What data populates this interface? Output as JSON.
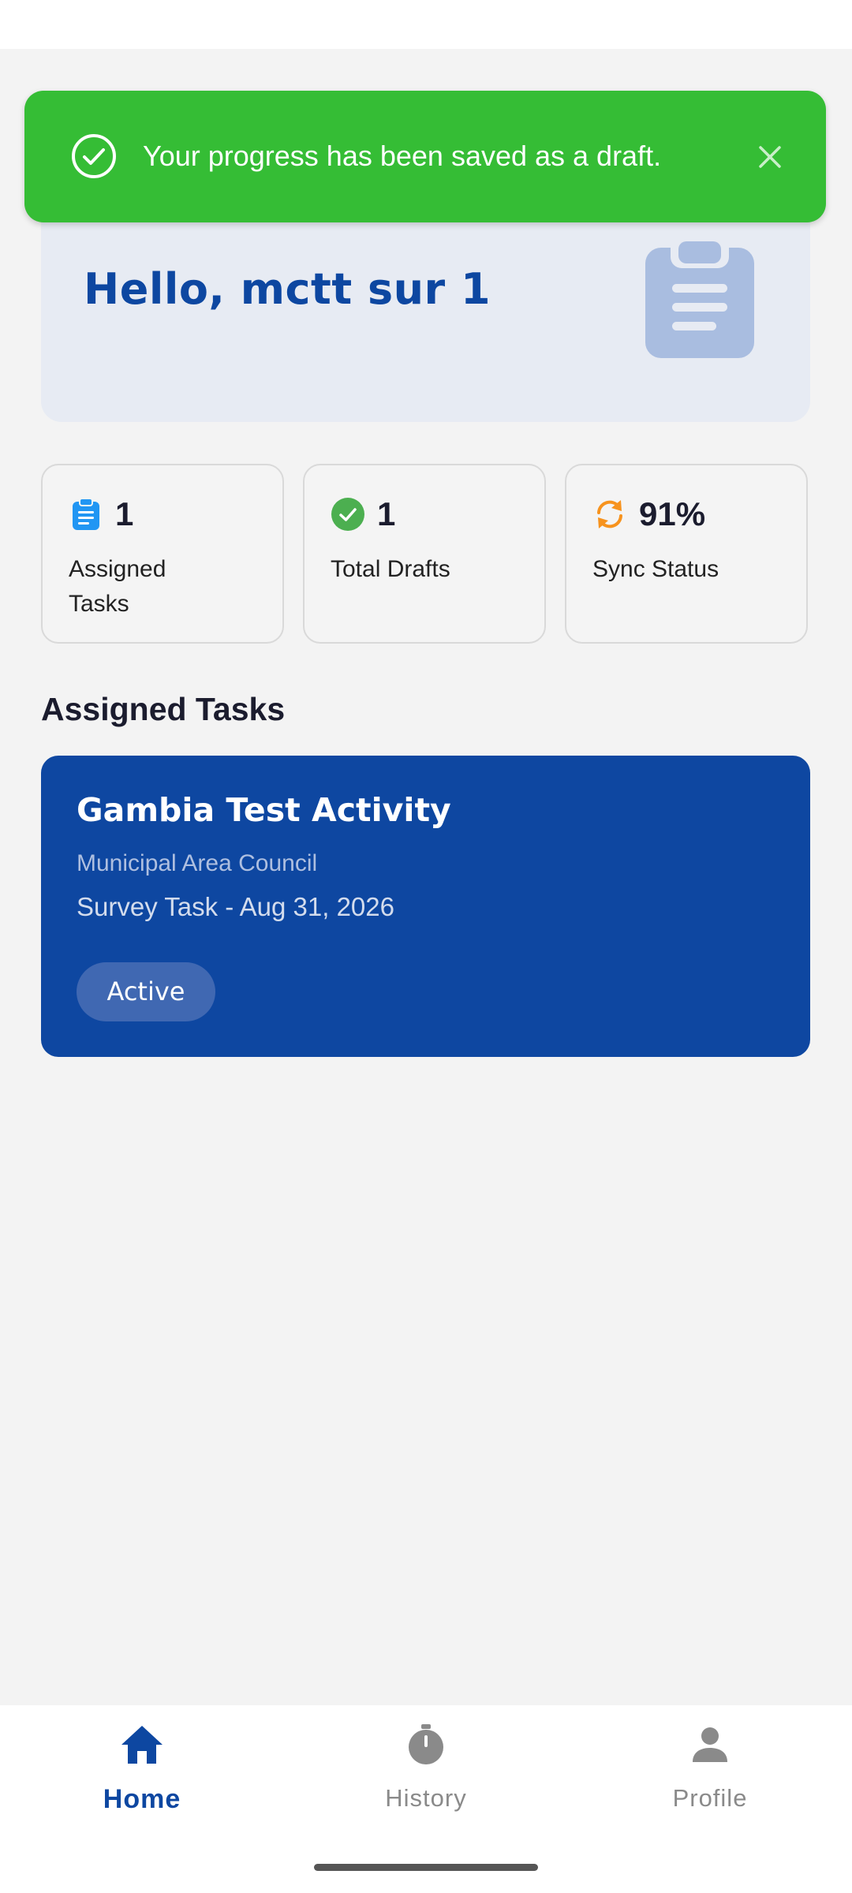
{
  "toast": {
    "message": "Your progress has been saved as a draft.",
    "icon": "check-circle-icon",
    "close_icon": "close-icon",
    "color": "#35bd35"
  },
  "greeting": {
    "text": "Hello, mctt sur 1",
    "illustration": "clipboard-icon"
  },
  "stats": [
    {
      "value": "1",
      "label": "Assigned Tasks",
      "icon": "clipboard-icon",
      "icon_color": "#2196f3"
    },
    {
      "value": "1",
      "label": "Total Drafts",
      "icon": "check-circle-icon",
      "icon_color": "#4caf50"
    },
    {
      "value": "91%",
      "label": "Sync Status",
      "icon": "sync-icon",
      "icon_color": "#f7931e"
    }
  ],
  "section_title": "Assigned Tasks",
  "task": {
    "title": "Gambia Test Activity",
    "subtitle": "Municipal Area Council",
    "meta": "Survey Task - Aug 31, 2026",
    "status": "Active",
    "color": "#0e47a1"
  },
  "nav": [
    {
      "label": "Home",
      "icon": "home-icon",
      "active": true
    },
    {
      "label": "History",
      "icon": "stopwatch-icon",
      "active": false
    },
    {
      "label": "Profile",
      "icon": "person-icon",
      "active": false
    }
  ],
  "colors": {
    "primary": "#0d47a1",
    "background": "#f3f3f3",
    "inactive_nav": "#8a8a8a"
  }
}
